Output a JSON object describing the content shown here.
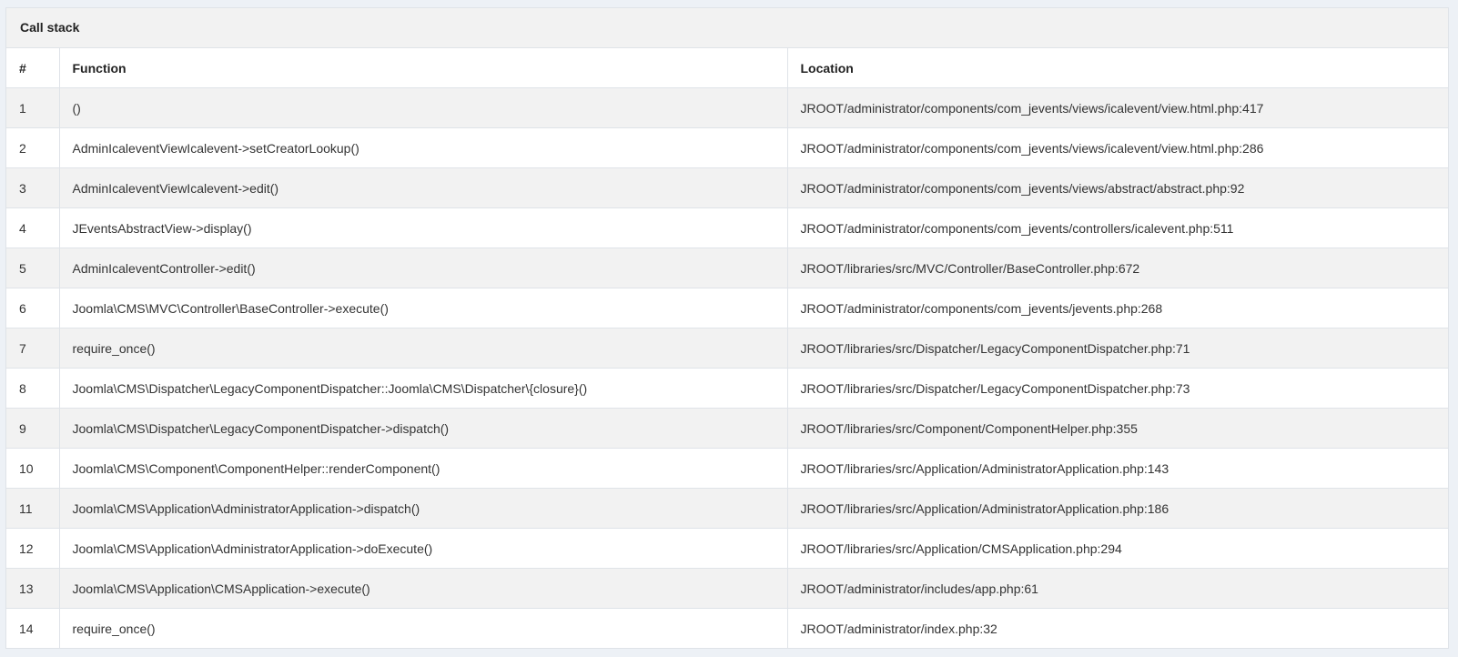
{
  "panel": {
    "title": "Call stack"
  },
  "table": {
    "columns": [
      "#",
      "Function",
      "Location"
    ],
    "rows": [
      {
        "num": "1",
        "function": "()",
        "location": "JROOT/administrator/components/com_jevents/views/icalevent/view.html.php:417"
      },
      {
        "num": "2",
        "function": "AdminIcaleventViewIcalevent->setCreatorLookup()",
        "location": "JROOT/administrator/components/com_jevents/views/icalevent/view.html.php:286"
      },
      {
        "num": "3",
        "function": "AdminIcaleventViewIcalevent->edit()",
        "location": "JROOT/administrator/components/com_jevents/views/abstract/abstract.php:92"
      },
      {
        "num": "4",
        "function": "JEventsAbstractView->display()",
        "location": "JROOT/administrator/components/com_jevents/controllers/icalevent.php:511"
      },
      {
        "num": "5",
        "function": "AdminIcaleventController->edit()",
        "location": "JROOT/libraries/src/MVC/Controller/BaseController.php:672"
      },
      {
        "num": "6",
        "function": "Joomla\\CMS\\MVC\\Controller\\BaseController->execute()",
        "location": "JROOT/administrator/components/com_jevents/jevents.php:268"
      },
      {
        "num": "7",
        "function": "require_once()",
        "location": "JROOT/libraries/src/Dispatcher/LegacyComponentDispatcher.php:71"
      },
      {
        "num": "8",
        "function": "Joomla\\CMS\\Dispatcher\\LegacyComponentDispatcher::Joomla\\CMS\\Dispatcher\\{closure}()",
        "location": "JROOT/libraries/src/Dispatcher/LegacyComponentDispatcher.php:73"
      },
      {
        "num": "9",
        "function": "Joomla\\CMS\\Dispatcher\\LegacyComponentDispatcher->dispatch()",
        "location": "JROOT/libraries/src/Component/ComponentHelper.php:355"
      },
      {
        "num": "10",
        "function": "Joomla\\CMS\\Component\\ComponentHelper::renderComponent()",
        "location": "JROOT/libraries/src/Application/AdministratorApplication.php:143"
      },
      {
        "num": "11",
        "function": "Joomla\\CMS\\Application\\AdministratorApplication->dispatch()",
        "location": "JROOT/libraries/src/Application/AdministratorApplication.php:186"
      },
      {
        "num": "12",
        "function": "Joomla\\CMS\\Application\\AdministratorApplication->doExecute()",
        "location": "JROOT/libraries/src/Application/CMSApplication.php:294"
      },
      {
        "num": "13",
        "function": "Joomla\\CMS\\Application\\CMSApplication->execute()",
        "location": "JROOT/administrator/includes/app.php:61"
      },
      {
        "num": "14",
        "function": "require_once()",
        "location": "JROOT/administrator/index.php:32"
      }
    ]
  }
}
